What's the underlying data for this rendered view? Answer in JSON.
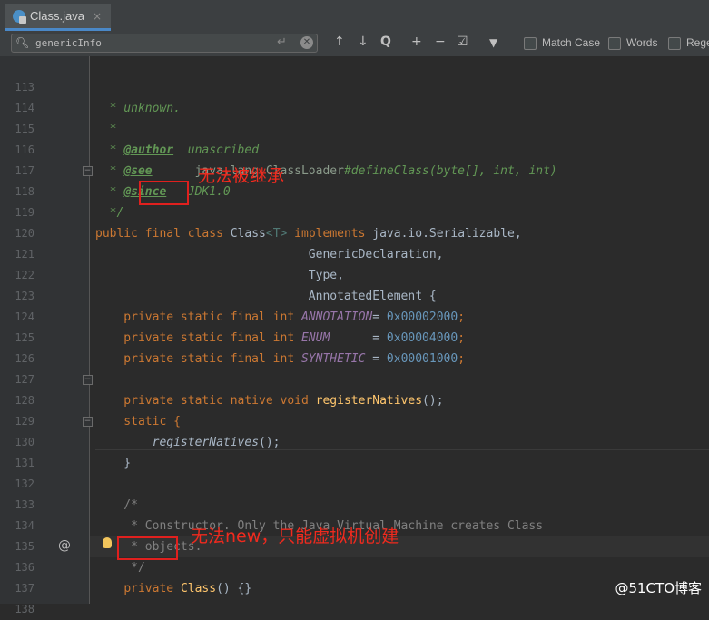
{
  "tab": {
    "label": "Class.java",
    "close": "×",
    "icon": "java-class-icon"
  },
  "search": {
    "value": "genericInfo",
    "enter_glyph": "↵",
    "clear_glyph": "✕",
    "up": "↑",
    "down": "↓",
    "find_all": "Q",
    "add": "+",
    "remove": "−",
    "select_all": "☑",
    "filter": "▼",
    "match_case_label": "Match Case",
    "words_label": "Words",
    "regex_label": "Rege"
  },
  "line_numbers": [
    "113",
    "114",
    "115",
    "116",
    "117",
    "118",
    "119",
    "120",
    "121",
    "122",
    "123",
    "124",
    "125",
    "126",
    "127",
    "128",
    "129",
    "130",
    "131",
    "132",
    "133",
    "134",
    "135",
    "136",
    "137",
    "138"
  ],
  "code": {
    "l113": "  * unknown.",
    "l114": "  *",
    "l115_star": "  * ",
    "l115_tag": "@author",
    "l115_val": "  unascribed",
    "l116_star": "  * ",
    "l116_tag": "@see",
    "l116_ref": "      java.lang.ClassLoader",
    "l116_rest": "#defineClass(byte[], int, int)",
    "l117_star": "  * ",
    "l117_tag": "@since",
    "l117_val": "   JDK1.0",
    "l118": "  */",
    "l119_public": "public ",
    "l119_final": "final",
    "l119_class": " class ",
    "l119_name": "Class",
    "l119_gen": "<T>",
    "l119_impl": " implements ",
    "l119_rest": "java.io.Serializable,",
    "l120": "                              GenericDeclaration,",
    "l121": "                              Type,",
    "l122": "                              AnnotatedElement {",
    "field_prefix": "    private static final int ",
    "l123_field": "ANNOTATION",
    "l123_eq": "= ",
    "l123_num": "0x00002000",
    "l124_field": "ENUM",
    "l124_eq": "      = ",
    "l124_num": "0x00004000",
    "l125_field": "SYNTHETIC",
    "l125_eq": " = ",
    "l125_num": "0x00001000",
    "semicolon": ";",
    "l127_kw": "    private static native void ",
    "l127_meth": "registerNatives",
    "l127_end": "();",
    "l128": "    static {",
    "l129_indent": "        ",
    "l129_call": "registerNatives",
    "l129_end": "();",
    "l130": "    }",
    "l132": "    /*",
    "l133": "     * Constructor. Only the Java Virtual Machine creates Class",
    "l134": "     * objects.",
    "l135": "     */",
    "l136_indent": "    ",
    "l136_private": "private",
    "l136_space": " ",
    "l136_name": "Class",
    "l136_end": "() {}"
  },
  "annotations": {
    "final_note": "无法被继承",
    "ctor_note": "无法new，只能虚拟机创建"
  },
  "gutter_at": "@",
  "watermark": "@51CTO博客"
}
